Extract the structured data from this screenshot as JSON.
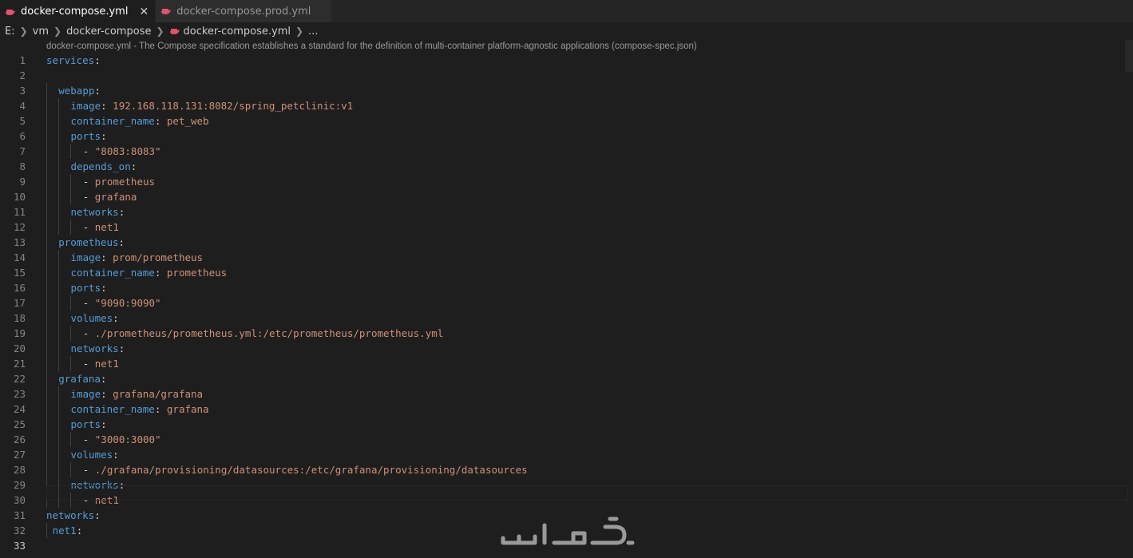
{
  "tabs": [
    {
      "label": "docker-compose.yml",
      "active": true,
      "close": "✕"
    },
    {
      "label": "docker-compose.prod.yml",
      "active": false
    }
  ],
  "breadcrumb": {
    "parts": [
      "E:",
      "vm",
      "docker-compose",
      "docker-compose.yml",
      "..."
    ]
  },
  "codelens": "docker-compose.yml - The Compose specification establishes a standard for the definition of multi-container platform-agnostic applications (compose-spec.json)",
  "lines": [
    {
      "n": "1",
      "indent": 0,
      "key": "services",
      "sep": ":",
      "val": ""
    },
    {
      "n": "2",
      "indent": 0,
      "key": "",
      "sep": "",
      "val": ""
    },
    {
      "n": "3",
      "indent": 1,
      "key": "webapp",
      "sep": ":",
      "val": ""
    },
    {
      "n": "4",
      "indent": 2,
      "key": "image",
      "sep": ": ",
      "val": "192.168.118.131:8082/spring_petclinic:v1"
    },
    {
      "n": "5",
      "indent": 2,
      "key": "container_name",
      "sep": ": ",
      "val": "pet_web"
    },
    {
      "n": "6",
      "indent": 2,
      "key": "ports",
      "sep": ":",
      "val": ""
    },
    {
      "n": "7",
      "indent": 3,
      "key": "",
      "sep": "- ",
      "val": "\"8083:8083\""
    },
    {
      "n": "8",
      "indent": 2,
      "key": "depends_on",
      "sep": ":",
      "val": ""
    },
    {
      "n": "9",
      "indent": 3,
      "key": "",
      "sep": "- ",
      "val": "prometheus"
    },
    {
      "n": "10",
      "indent": 3,
      "key": "",
      "sep": "- ",
      "val": "grafana"
    },
    {
      "n": "11",
      "indent": 2,
      "key": "networks",
      "sep": ":",
      "val": ""
    },
    {
      "n": "12",
      "indent": 3,
      "key": "",
      "sep": "- ",
      "val": "net1"
    },
    {
      "n": "13",
      "indent": 1,
      "key": "prometheus",
      "sep": ":",
      "val": ""
    },
    {
      "n": "14",
      "indent": 2,
      "key": "image",
      "sep": ": ",
      "val": "prom/prometheus"
    },
    {
      "n": "15",
      "indent": 2,
      "key": "container_name",
      "sep": ": ",
      "val": "prometheus"
    },
    {
      "n": "16",
      "indent": 2,
      "key": "ports",
      "sep": ":",
      "val": ""
    },
    {
      "n": "17",
      "indent": 3,
      "key": "",
      "sep": "- ",
      "val": "\"9090:9090\""
    },
    {
      "n": "18",
      "indent": 2,
      "key": "volumes",
      "sep": ":",
      "val": ""
    },
    {
      "n": "19",
      "indent": 3,
      "key": "",
      "sep": "- ",
      "val": "./prometheus/prometheus.yml:/etc/prometheus/prometheus.yml"
    },
    {
      "n": "20",
      "indent": 2,
      "key": "networks",
      "sep": ":",
      "val": ""
    },
    {
      "n": "21",
      "indent": 3,
      "key": "",
      "sep": "- ",
      "val": "net1"
    },
    {
      "n": "22",
      "indent": 1,
      "key": "grafana",
      "sep": ":",
      "val": ""
    },
    {
      "n": "23",
      "indent": 2,
      "key": "image",
      "sep": ": ",
      "val": "grafana/grafana"
    },
    {
      "n": "24",
      "indent": 2,
      "key": "container_name",
      "sep": ": ",
      "val": "grafana"
    },
    {
      "n": "25",
      "indent": 2,
      "key": "ports",
      "sep": ":",
      "val": ""
    },
    {
      "n": "26",
      "indent": 3,
      "key": "",
      "sep": "- ",
      "val": "\"3000:3000\""
    },
    {
      "n": "27",
      "indent": 2,
      "key": "volumes",
      "sep": ":",
      "val": ""
    },
    {
      "n": "28",
      "indent": 3,
      "key": "",
      "sep": "- ",
      "val": "./grafana/provisioning/datasources:/etc/grafana/provisioning/datasources"
    },
    {
      "n": "29",
      "indent": 2,
      "key": "networks",
      "sep": ":",
      "val": ""
    },
    {
      "n": "30",
      "indent": 3,
      "key": "",
      "sep": "- ",
      "val": "net1"
    },
    {
      "n": "31",
      "indent": 0,
      "key": "networks",
      "sep": ":",
      "val": ""
    },
    {
      "n": "32",
      "indent": 0.5,
      "key": "net1",
      "sep": ":",
      "val": ""
    },
    {
      "n": "33",
      "indent": 0,
      "key": "",
      "sep": "",
      "val": "",
      "current": true
    }
  ],
  "colors": {
    "key": "#569cd6",
    "value": "#ce9178",
    "background": "#1e1e1e",
    "docker_icon": "#e2526f"
  },
  "watermark": "خدسات"
}
